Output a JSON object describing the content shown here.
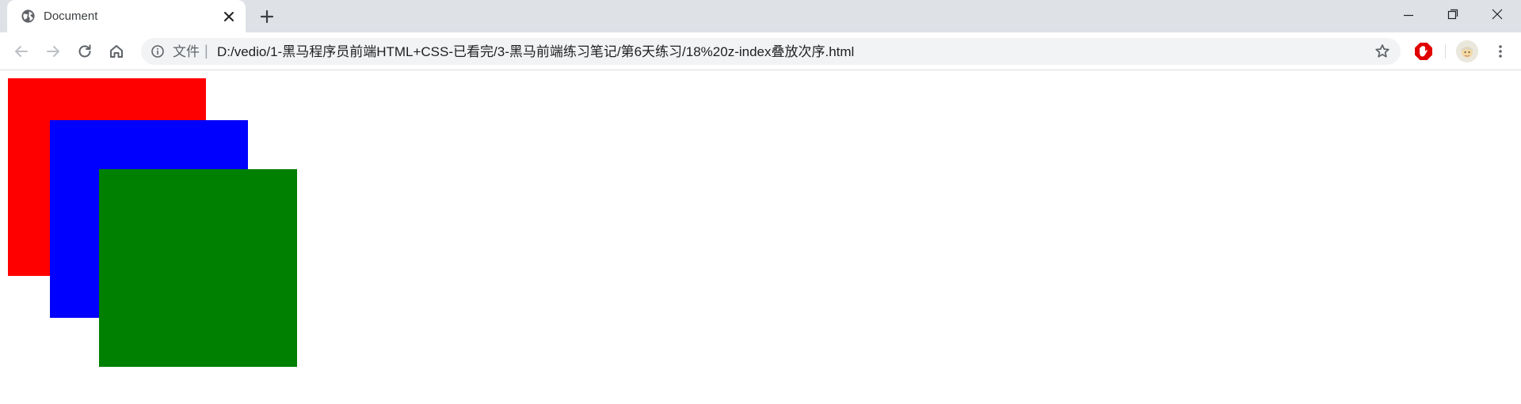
{
  "tab": {
    "title": "Document",
    "favicon": "globe-icon",
    "close_icon": "close-icon"
  },
  "newtab": {
    "icon": "plus-icon"
  },
  "window_controls": [
    "minimize-icon",
    "restore-icon",
    "close-icon"
  ],
  "toolbar": {
    "back_icon": "arrow-left-icon",
    "forward_icon": "arrow-right-icon",
    "reload_icon": "reload-icon",
    "home_icon": "home-icon",
    "star_icon": "star-icon",
    "extension_icon": "stop-hand-icon",
    "menu_icon": "kebab-menu-icon"
  },
  "address": {
    "scheme_label": "文件",
    "separator": "|",
    "url": "D:/vedio/1-黑马程序员前端HTML+CSS-已看完/3-黑马前端练习笔记/第6天练习/18%20z-index叠放次序.html"
  },
  "colors": {
    "tabstrip_bg": "#dee1e6",
    "omnibox_bg": "#f1f3f4",
    "box_red": "#ff0000",
    "box_blue": "#0000ff",
    "box_green": "#008000"
  },
  "page": {
    "boxes": [
      {
        "name": "red-box",
        "color": "red",
        "z_index": 1
      },
      {
        "name": "blue-box",
        "color": "blue",
        "z_index": 2
      },
      {
        "name": "green-box",
        "color": "green",
        "z_index": 3
      }
    ]
  }
}
